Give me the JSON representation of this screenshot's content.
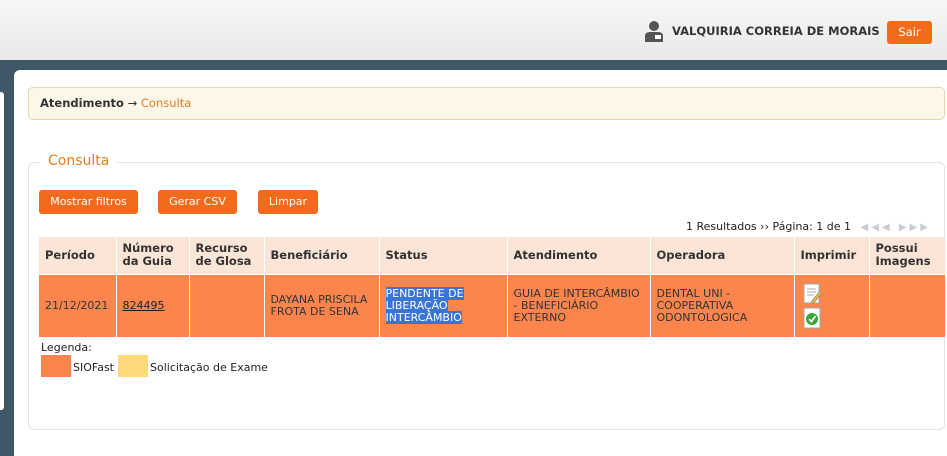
{
  "header": {
    "user_icon": "user-icon",
    "user_name": "VALQUIRIA CORREIA DE MORAIS",
    "logout_label": "Sair"
  },
  "breadcrumb": {
    "root": "Atendimento",
    "separator": "→",
    "current": "Consulta"
  },
  "panel": {
    "title": "Consulta",
    "buttons": {
      "filters": "Mostrar filtros",
      "csv": "Gerar CSV",
      "clear": "Limpar"
    }
  },
  "pager": {
    "results": "1 Resultados ››",
    "page_label": "Página: 1 de 1",
    "nav_icons": "first-prev-next-last-icons"
  },
  "table": {
    "columns": [
      "Período",
      "Número da Guia",
      "Recurso de Glosa",
      "Beneficiário",
      "Status",
      "Atendimento",
      "Operadora",
      "Imprimir",
      "Possui Imagens"
    ],
    "rows": [
      {
        "periodo": "21/12/2021",
        "numero_guia": "824495",
        "recurso_glosa": "",
        "beneficiario": "DAYANA PRISCILA FROTA DE SENA",
        "status": "PENDENTE DE LIBERAÇÃO INTERCÂMBIO",
        "atendimento": "GUIA DE INTERCÂMBIO - BENEFICIÁRIO EXTERNO",
        "operadora": "DENTAL UNI - COOPERATIVA ODONTOLOGICA",
        "imprimir_icons": [
          "print-document-icon",
          "print-check-icon"
        ],
        "possui_imagens": ""
      }
    ]
  },
  "legend": {
    "title": "Legenda:",
    "items": [
      {
        "label": "SIOFast",
        "color": "#fb854d"
      },
      {
        "label": "Solicitação de Exame",
        "color": "#fdd97a"
      }
    ]
  },
  "colors": {
    "accent": "#f26b1d",
    "row_highlight": "#fb854d",
    "header_row": "#fbe5d6",
    "frame": "#3f5766"
  }
}
